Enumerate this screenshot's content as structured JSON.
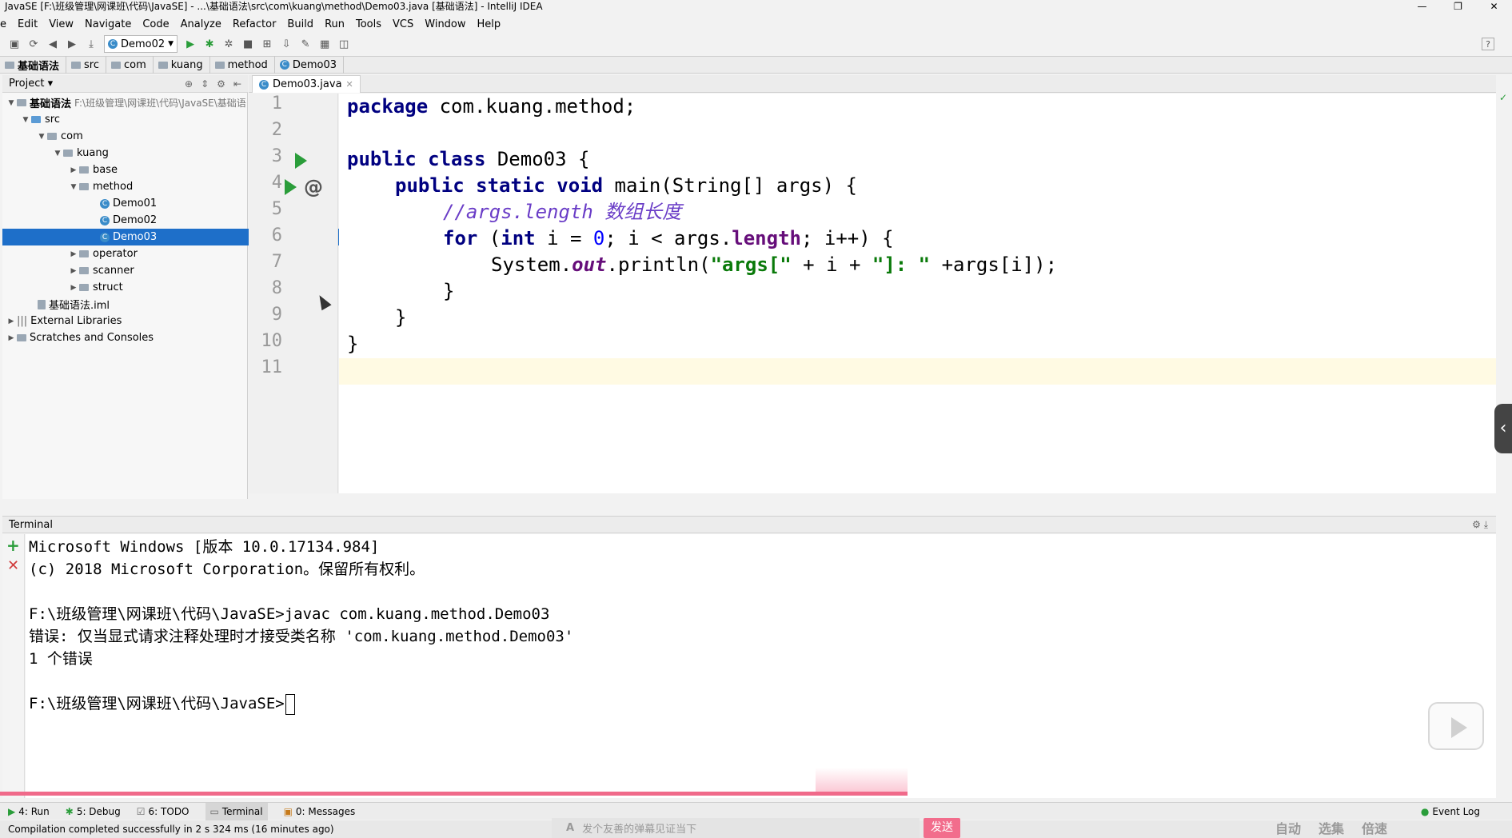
{
  "window": {
    "title": "JavaSE [F:\\班级管理\\网课班\\代码\\JavaSE] - ...\\基础语法\\src\\com\\kuang\\method\\Demo03.java [基础语法] - IntelliJ IDEA",
    "controls": [
      "—",
      "❐",
      "✕"
    ]
  },
  "menu": [
    "e",
    "Edit",
    "View",
    "Navigate",
    "Code",
    "Analyze",
    "Refactor",
    "Build",
    "Run",
    "Tools",
    "VCS",
    "Window",
    "Help"
  ],
  "toolbar": {
    "run_config": "Demo02",
    "help": "?"
  },
  "breadcrumb": [
    "基础语法",
    "src",
    "com",
    "kuang",
    "method",
    "Demo03"
  ],
  "project": {
    "header": "Project",
    "root_label": "基础语法",
    "root_path": "F:\\班级管理\\网课班\\代码\\JavaSE\\基础语",
    "tree": {
      "src": "src",
      "com": "com",
      "kuang": "kuang",
      "base": "base",
      "method": "method",
      "demo01": "Demo01",
      "demo02": "Demo02",
      "demo03": "Demo03",
      "operator": "operator",
      "scanner": "scanner",
      "struct": "struct",
      "iml": "基础语法.iml",
      "external": "External Libraries",
      "scratches": "Scratches and Consoles"
    }
  },
  "editor": {
    "tab": "Demo03.java",
    "line_numbers": [
      "1",
      "2",
      "3",
      "4",
      "5",
      "6",
      "7",
      "8",
      "9",
      "10",
      "11"
    ],
    "code": {
      "l1_kw": "package",
      "l1_rest": " com.kuang.method;",
      "l3_kw": "public class",
      "l3_rest": " Demo03 {",
      "l4_kw": "public static void",
      "l4_rest": " main(String[] args) {",
      "l5_comment": "//args.length 数组长度",
      "l6_kw1": "for",
      "l6_a": " (",
      "l6_kw2": "int",
      "l6_b": " i = ",
      "l6_num": "0",
      "l6_c": "; i < args.",
      "l6_fld": "length",
      "l6_d": "; i++) {",
      "l7_a": "System.",
      "l7_sf": "out",
      "l7_b": ".println(",
      "l7_s1": "\"args[\"",
      "l7_c": " + i + ",
      "l7_s2": "\"]: \"",
      "l7_d": " +args[i]);",
      "l8": "}",
      "l9": "}",
      "l10": "}"
    }
  },
  "terminal": {
    "header": "Terminal",
    "lines": [
      "Microsoft Windows [版本 10.0.17134.984]",
      "(c) 2018 Microsoft Corporation。保留所有权利。",
      "",
      "F:\\班级管理\\网课班\\代码\\JavaSE>javac com.kuang.method.Demo03",
      "错误: 仅当显式请求注释处理时才接受类名称 'com.kuang.method.Demo03'",
      "1 个错误",
      "",
      "F:\\班级管理\\网课班\\代码\\JavaSE>"
    ]
  },
  "bottom_tools": [
    "4: Run",
    "5: Debug",
    "6: TODO",
    "Terminal",
    "0: Messages"
  ],
  "event_log": "Event Log",
  "status": "Compilation completed successfully in 2 s 324 ms (16 minutes ago)",
  "video_overlay": {
    "danmaku_placeholder": "发个友善的弹幕见证当下",
    "send": "发送",
    "labels": [
      "自动",
      "选集",
      "倍速"
    ]
  },
  "colors": {
    "selection": "#1e6fc9",
    "keyword": "#000080",
    "string": "#0a7a0a",
    "comment": "#6a3dc7",
    "run_green": "#2a9d3a",
    "send_pink": "#f26d8c"
  }
}
